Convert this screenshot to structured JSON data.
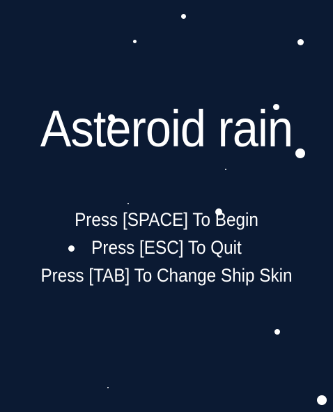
{
  "game": {
    "title": "Asteroid rain",
    "menu": {
      "start": "Press [SPACE] To Begin",
      "quit": "Press [ESC] To Quit",
      "skin": "Press [TAB] To Change Ship Skin"
    }
  },
  "colors": {
    "background": "#0b1a33",
    "text": "#ffffff",
    "stars": "#ffffff"
  }
}
